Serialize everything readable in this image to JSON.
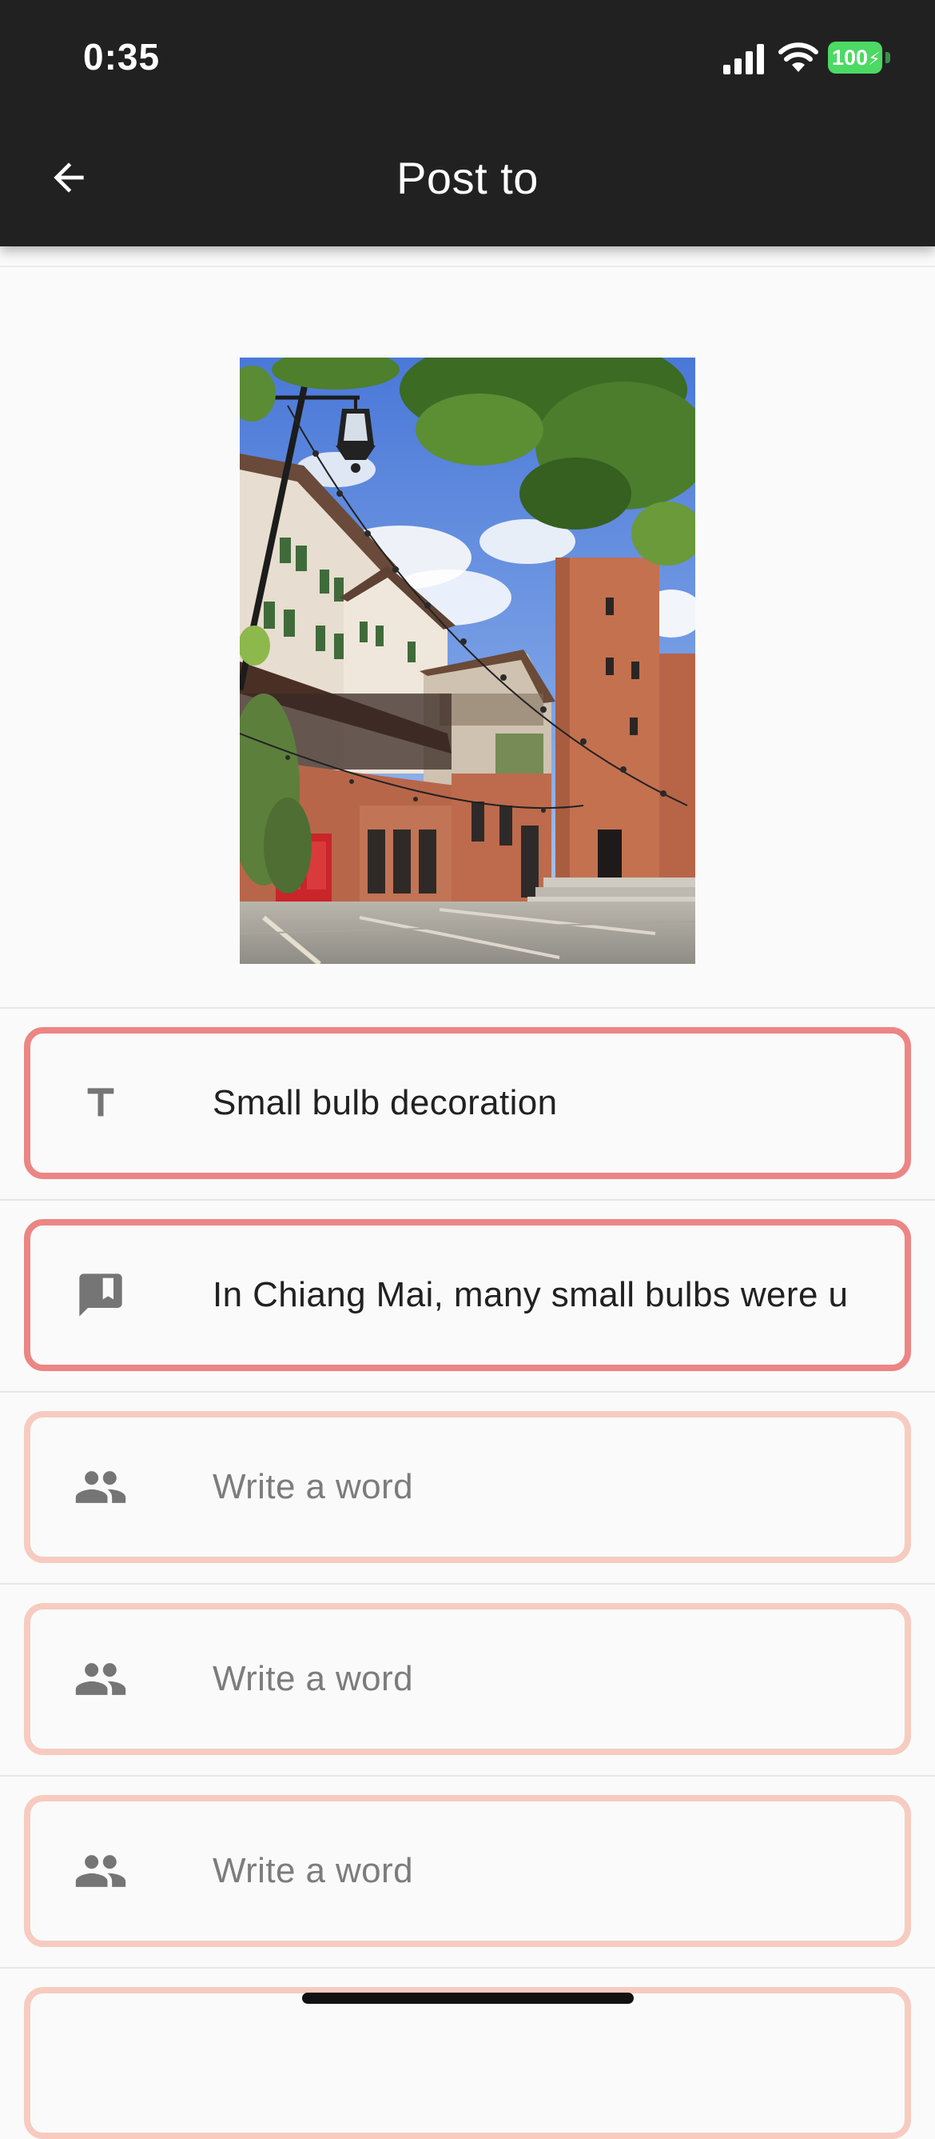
{
  "status_bar": {
    "time": "0:35",
    "battery_level": "100",
    "battery_color": "#4cd964",
    "icons": [
      "signal-icon",
      "wifi-icon",
      "battery-icon"
    ]
  },
  "app_bar": {
    "title": "Post to",
    "back_icon": "arrow-left-icon",
    "background": "#212121"
  },
  "photo": {
    "subject": "courtyard with brick tower, lamp post and string bulbs"
  },
  "fields": {
    "title_field": {
      "icon": "text-t-icon",
      "value": "Small bulb decoration"
    },
    "description_field": {
      "icon": "comment-bookmark-icon",
      "value": "In Chiang Mai, many small bulbs were u"
    },
    "tag_field_1": {
      "icon": "people-icon",
      "placeholder": "Write a word"
    },
    "tag_field_2": {
      "icon": "people-icon",
      "placeholder": "Write a word"
    },
    "tag_field_3": {
      "icon": "people-icon",
      "placeholder": "Write a word"
    }
  },
  "colors": {
    "field_border_filled": "#ec8584",
    "field_border_empty": "#f7cbc0",
    "page_background": "#fafafa"
  }
}
